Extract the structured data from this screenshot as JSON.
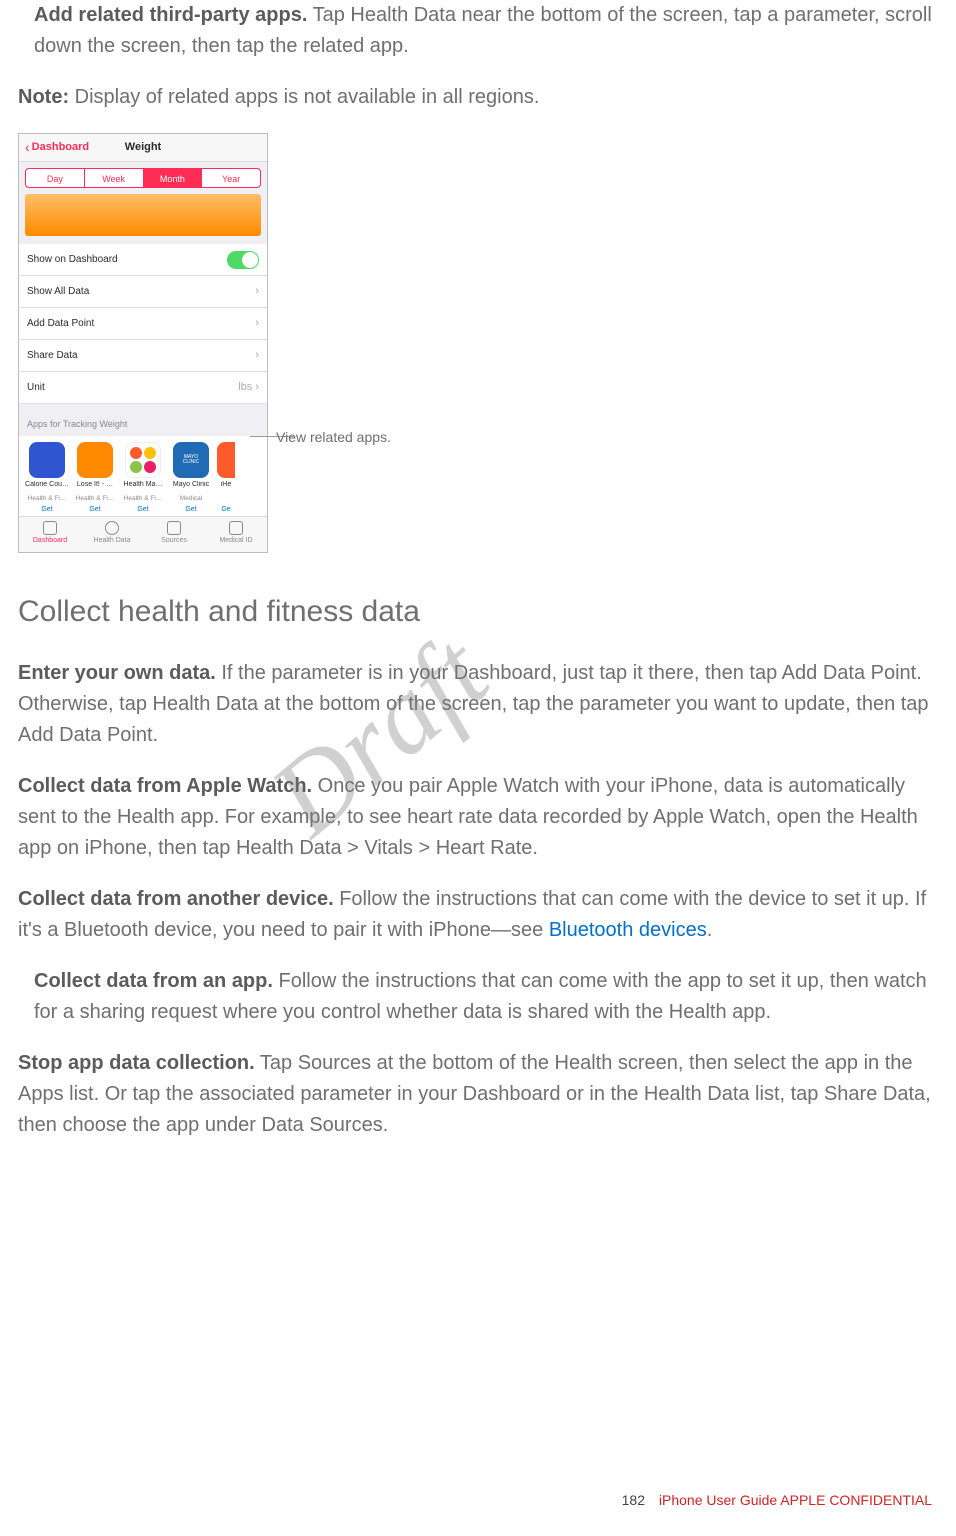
{
  "intro": {
    "p1_bold": "Add related third-party apps.",
    "p1_rest": " Tap Health Data near the bottom of the screen, tap a parameter, scroll down the screen, then tap the related app.",
    "note_bold": "Note:",
    "note_rest": " Display of related apps is not available in all regions."
  },
  "shot": {
    "back": "Dashboard",
    "title": "Weight",
    "seg": [
      "Day",
      "Week",
      "Month",
      "Year"
    ],
    "seg_active": 2,
    "rows": {
      "dash": "Show on Dashboard",
      "all": "Show All Data",
      "add": "Add Data Point",
      "share": "Share Data",
      "unit": "Unit",
      "unit_val": "lbs"
    },
    "appsLabel": "Apps for Tracking Weight",
    "apps": [
      {
        "name": "Calorie Cou…",
        "sub": "Health & Fi…",
        "get": "Get",
        "color": "#2f55d0"
      },
      {
        "name": "Lose It! - …",
        "sub": "Health & Fi…",
        "get": "Get",
        "color": "#ff8a00"
      },
      {
        "name": "Health Ma…",
        "sub": "Health & Fi…",
        "get": "Get",
        "color": "#ffffff"
      },
      {
        "name": "Mayo Clinic",
        "sub": "Medical",
        "get": "Get",
        "color": "#1f6bb5"
      },
      {
        "name": "iHe",
        "sub": "",
        "get": "Ge",
        "color": "#ff5a2b"
      }
    ],
    "tabs": [
      "Dashboard",
      "Health Data",
      "Sources",
      "Medical ID"
    ],
    "callout": "View related apps."
  },
  "heading": "Collect health and fitness data",
  "body": {
    "p1_bold": "Enter your own data.",
    "p1_rest": " If the parameter is in your Dashboard, just tap it there, then tap Add Data Point. Otherwise, tap Health Data at the bottom of the screen, tap the parameter you want to update, then tap Add Data Point.",
    "p2_bold": "Collect data from Apple Watch.",
    "p2_rest": " Once you pair Apple Watch with your iPhone, data is automatically sent to the Health app. For example, to see heart rate data recorded by Apple Watch, open the Health app on iPhone, then tap Health Data > Vitals > Heart Rate.",
    "p3_bold": "Collect data from another device.",
    "p3_rest_a": " Follow the instructions that can come with the device to set it up. If it's a Bluetooth device, you need to pair it with iPhone—see ",
    "p3_link": "Bluetooth devices",
    "p3_rest_b": ".",
    "p4_bold": "Collect data from an app.",
    "p4_rest": " Follow the instructions that can come with the app to set it up, then watch for a sharing request where you control whether data is shared with the Health app.",
    "p5_bold": "Stop app data collection.",
    "p5_rest": " Tap Sources at the bottom of the Health screen, then select the app in the Apps list. Or tap the associated parameter in your Dashboard or in the Health Data list, tap Share Data, then choose the app under Data Sources."
  },
  "watermark": "Draft",
  "footer": {
    "page": "182",
    "text": "iPhone User Guide  APPLE CONFIDENTIAL"
  }
}
